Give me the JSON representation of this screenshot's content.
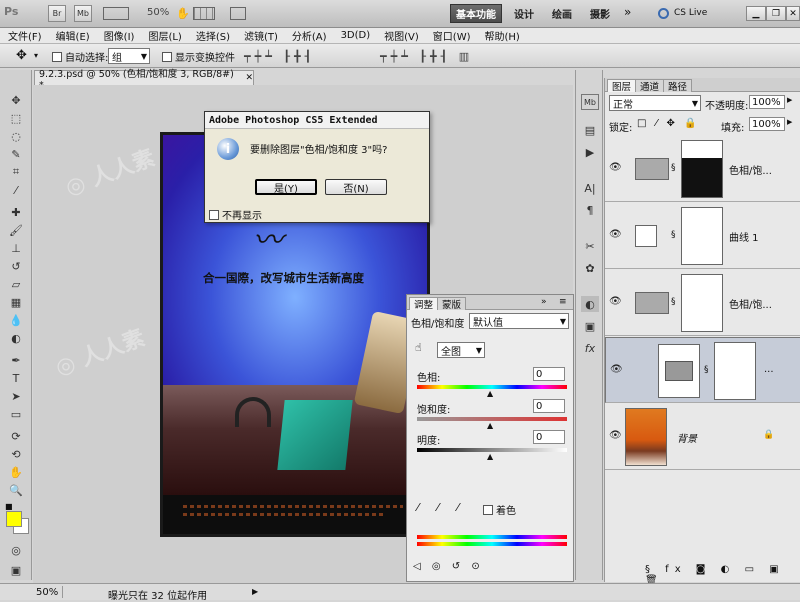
{
  "appbar": {
    "ps_logo": "Ps",
    "br_label": "Br",
    "mb_label": "Mb",
    "zoom": "50%",
    "workspaces": [
      "基本功能",
      "设计",
      "绘画",
      "摄影"
    ],
    "overflow": "»",
    "cs_live": "CS Live"
  },
  "menu": [
    "文件(F)",
    "编辑(E)",
    "图像(I)",
    "图层(L)",
    "选择(S)",
    "滤镜(T)",
    "分析(A)",
    "3D(D)",
    "视图(V)",
    "窗口(W)",
    "帮助(H)"
  ],
  "options": {
    "auto_select_label": "自动选择:",
    "auto_select_value": "组",
    "show_transform_label": "显示变换控件"
  },
  "document": {
    "tab_title": "9.2.3.psd @ 50% (色相/饱和度 3, RGB/8#) *",
    "poster_headline": "合一国際，改写城市生活新高度"
  },
  "dialog": {
    "title": "Adobe Photoshop CS5 Extended",
    "message": "要删除图层\"色相/饱和度 3\"吗?",
    "yes_label": "是(Y)",
    "no_label": "否(N)",
    "dont_show_label": "不再显示"
  },
  "adjustments": {
    "tabs": [
      "调整",
      "蒙版"
    ],
    "title": "色相/饱和度",
    "preset": "默认值",
    "channel": "全图",
    "hue_label": "色相:",
    "hue_value": "0",
    "saturation_label": "饱和度:",
    "saturation_value": "0",
    "lightness_label": "明度:",
    "lightness_value": "0",
    "colorize_label": "着色"
  },
  "layers_panel": {
    "tabs": [
      "图层",
      "通道",
      "路径"
    ],
    "blend_mode": "正常",
    "opacity_label": "不透明度:",
    "opacity_value": "100%",
    "lock_label": "锁定:",
    "fill_label": "填充:",
    "fill_value": "100%",
    "layers": [
      {
        "name": "色相/饱..."
      },
      {
        "name": "曲线 1"
      },
      {
        "name": "色相/饱..."
      },
      {
        "name": "..."
      },
      {
        "name": "背景"
      }
    ]
  },
  "status": {
    "zoom": "50%",
    "info": "曝光只在 32 位起作用"
  },
  "colors": {
    "foreground": "#ffff00",
    "background": "#ffffff"
  }
}
